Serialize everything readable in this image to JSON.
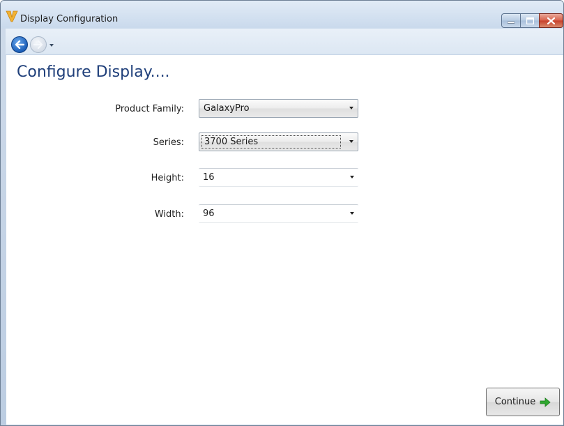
{
  "window": {
    "title": "Display Configuration",
    "app_icon": "v-logo-icon",
    "controls": [
      "minimize-icon",
      "maximize-icon",
      "close-icon"
    ]
  },
  "nav": {
    "back_icon": "back-arrow-icon",
    "forward_icon": "forward-arrow-icon",
    "dropdown_icon": "chevron-down-icon"
  },
  "page": {
    "title": "Configure Display...."
  },
  "form": {
    "product_family": {
      "label": "Product Family:",
      "value": "GalaxyPro"
    },
    "series": {
      "label": "Series:",
      "value": "3700 Series"
    },
    "height": {
      "label": "Height:",
      "value": "16"
    },
    "width": {
      "label": "Width:",
      "value": "96"
    }
  },
  "actions": {
    "continue_label": "Continue",
    "continue_icon": "green-arrow-right-icon"
  },
  "colors": {
    "title_blue": "#1f3f7a",
    "accent_green": "#2fa82f",
    "close_red": "#c7402a"
  }
}
